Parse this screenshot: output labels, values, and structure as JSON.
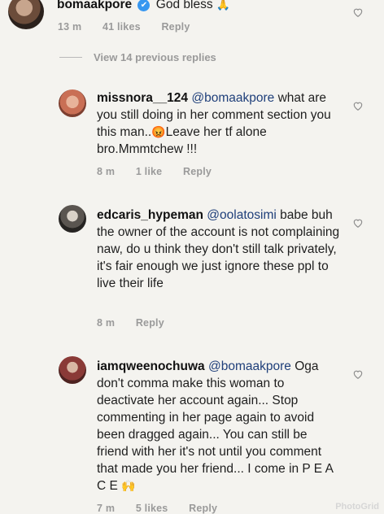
{
  "comments": [
    {
      "username": "bomaakpore",
      "verified": true,
      "text": "God bless",
      "emoji": "🙏",
      "time": "13 m",
      "likes": "41 likes",
      "reply": "Reply"
    },
    {
      "username": "missnora__124",
      "mention": "@bomaakpore",
      "text": "what are you still doing in her comment section you this man..",
      "emoji": "😡",
      "text2": "Leave her tf alone bro.Mmmtchew !!!",
      "time": "8 m",
      "likes": "1 like",
      "reply": "Reply"
    },
    {
      "username": "edcaris_hypeman",
      "mention": "@oolatosimi",
      "text": "babe buh the owner of the account is not complaining naw, do u think they don't still talk privately, it's fair enough we just ignore these ppl to live their life",
      "time": "8 m",
      "reply": "Reply"
    },
    {
      "username": "iamqweenochuwa",
      "mention": "@bomaakpore",
      "text": "Oga don't comma make this woman to deactivate her account again... Stop commenting in her page again to avoid been dragged again... You can still be friend with her it's not until you comment that made you her friend... I come in P E A C E",
      "emoji": "🙌",
      "time": "7 m",
      "likes": "5 likes",
      "reply": "Reply"
    }
  ],
  "view_replies": "View 14 previous replies",
  "watermark": "PhotoGrid",
  "icons": {
    "like": "heart-outline-icon",
    "verified": "verified-badge-icon"
  },
  "colors": {
    "mention": "#1f3f7a",
    "meta": "#9a9a9a",
    "background": "#f4f3ef"
  }
}
